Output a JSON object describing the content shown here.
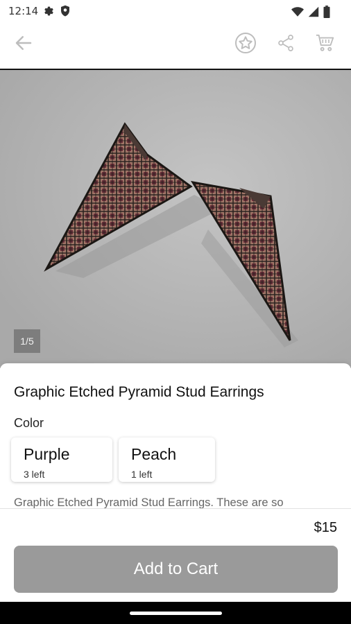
{
  "status": {
    "time": "12:14"
  },
  "icons": {
    "settings": "gear-icon",
    "shield": "shield-icon",
    "wifi": "wifi-icon",
    "signal": "signal-icon",
    "battery": "battery-icon",
    "back": "arrow-left-icon",
    "favorite": "star-icon",
    "share": "share-icon",
    "cart": "cart-icon"
  },
  "gallery": {
    "indicator": "1/5"
  },
  "product": {
    "title": "Graphic Etched Pyramid Stud Earrings",
    "color_label": "Color",
    "options": [
      {
        "name": "Purple",
        "stock": "3 left"
      },
      {
        "name": "Peach",
        "stock": "1 left"
      }
    ],
    "description": "Graphic Etched Pyramid Stud Earrings. These are so",
    "price": "$15",
    "cta_label": "Add to Cart"
  },
  "colors": {
    "image_bg": "#b3b3b3",
    "cta_bg": "#9a9a9a",
    "indicator_bg": "#7d7d7d"
  }
}
